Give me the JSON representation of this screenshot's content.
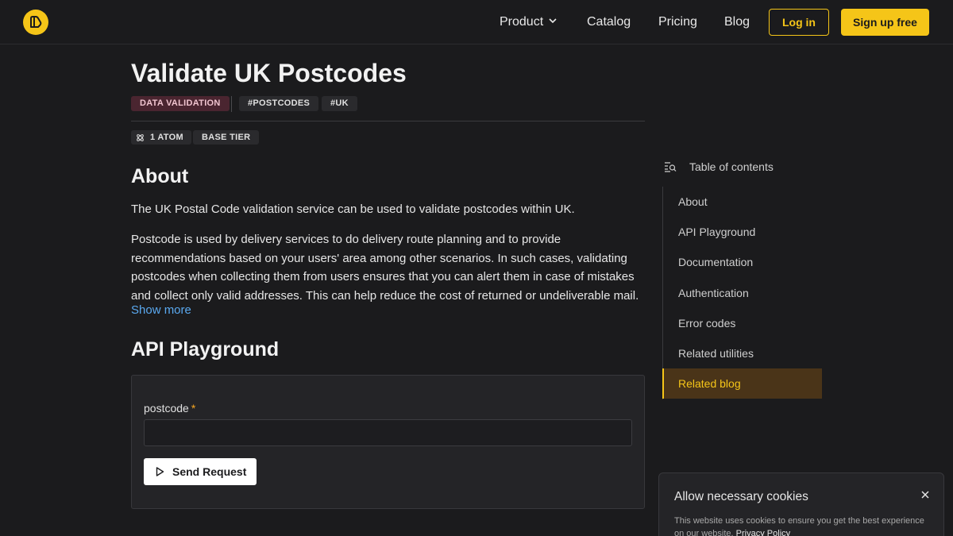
{
  "nav": {
    "product": "Product",
    "catalog": "Catalog",
    "pricing": "Pricing",
    "blog": "Blog",
    "login": "Log in",
    "signup": "Sign up free"
  },
  "page": {
    "title": "Validate UK Postcodes",
    "category_tag": "DATA VALIDATION",
    "tags": [
      "#POSTCODES",
      "#UK"
    ],
    "atom": "1 ATOM",
    "tier": "BASE TIER"
  },
  "about": {
    "heading": "About",
    "p1": "The UK Postal Code validation service can be used to validate postcodes within UK.",
    "p2": "Postcode is used by delivery services to do delivery route planning and to provide recommendations based on your users' area among other scenarios. In such cases, validating postcodes when collecting them from users ensures that you can alert them in case of mistakes and collect only valid addresses. This can help reduce the cost of returned or undeliverable mail.",
    "show_more": "Show more"
  },
  "playground": {
    "heading": "API Playground",
    "field_label": "postcode",
    "required_mark": "*",
    "field_value": "",
    "send_label": "Send Request"
  },
  "toc": {
    "heading": "Table of contents",
    "items": [
      "About",
      "API Playground",
      "Documentation",
      "Authentication",
      "Error codes",
      "Related utilities",
      "Related blog"
    ],
    "active_index": 6
  },
  "cookie": {
    "title": "Allow necessary cookies",
    "text": "This website uses cookies to ensure you get the best experience on our website.",
    "link": "Privacy Policy"
  },
  "colors": {
    "accent": "#f5c518",
    "background": "#1b1b1d",
    "link": "#5aa9f0"
  }
}
